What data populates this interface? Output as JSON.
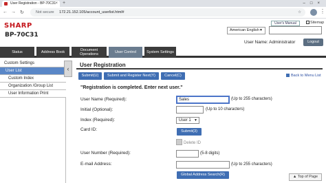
{
  "browser": {
    "tab_title": "User Registration - BP-70C31",
    "security": "Not secure",
    "url": "172.21.152.105/account_userlist.html#"
  },
  "header": {
    "brand": "SHARP",
    "model": "BP-70C31",
    "users_manual": "User's Manual",
    "sitemap": "Sitemap",
    "language": "American English",
    "user_label": "User Name: Administrator",
    "logout": "Logout"
  },
  "nav": {
    "tabs": [
      "Status",
      "Address Book",
      "Document Operations",
      "User Control",
      "System Settings"
    ],
    "active": "User Control"
  },
  "sidebar": {
    "items": [
      "Custom Settings",
      "User List",
      "Custom Index",
      "Organization /Group List",
      "User Information Print"
    ],
    "selected": "User List"
  },
  "main": {
    "title": "User Registration",
    "buttons": {
      "submit": "Submit(U)",
      "submit_next": "Submit and Register Next(Y)",
      "cancel": "Cancel(C)"
    },
    "back_link": "Back to Menu List",
    "message": "\"Registration is completed. Enter next user.\"",
    "fields": {
      "user_name_label": "User Name (Required):",
      "user_name_value": "Sales",
      "user_name_hint": "(Up to 255 characters)",
      "initial_label": "Initial (Optional):",
      "initial_hint": "(Up to 10 characters)",
      "index_label": "Index (Required):",
      "index_value": "User 1",
      "card_id_label": "Card ID:",
      "card_submit": "Submit(3)",
      "delete_id": "Delete ID",
      "user_number_label": "User Number (Required):",
      "user_number_hint": "(5-8 digits)",
      "email_label": "E-mail Address:",
      "email_hint": "(Up to 255 characters)",
      "global_search": "Global Address Search(R)"
    },
    "top_of_page": "Top of Page"
  }
}
